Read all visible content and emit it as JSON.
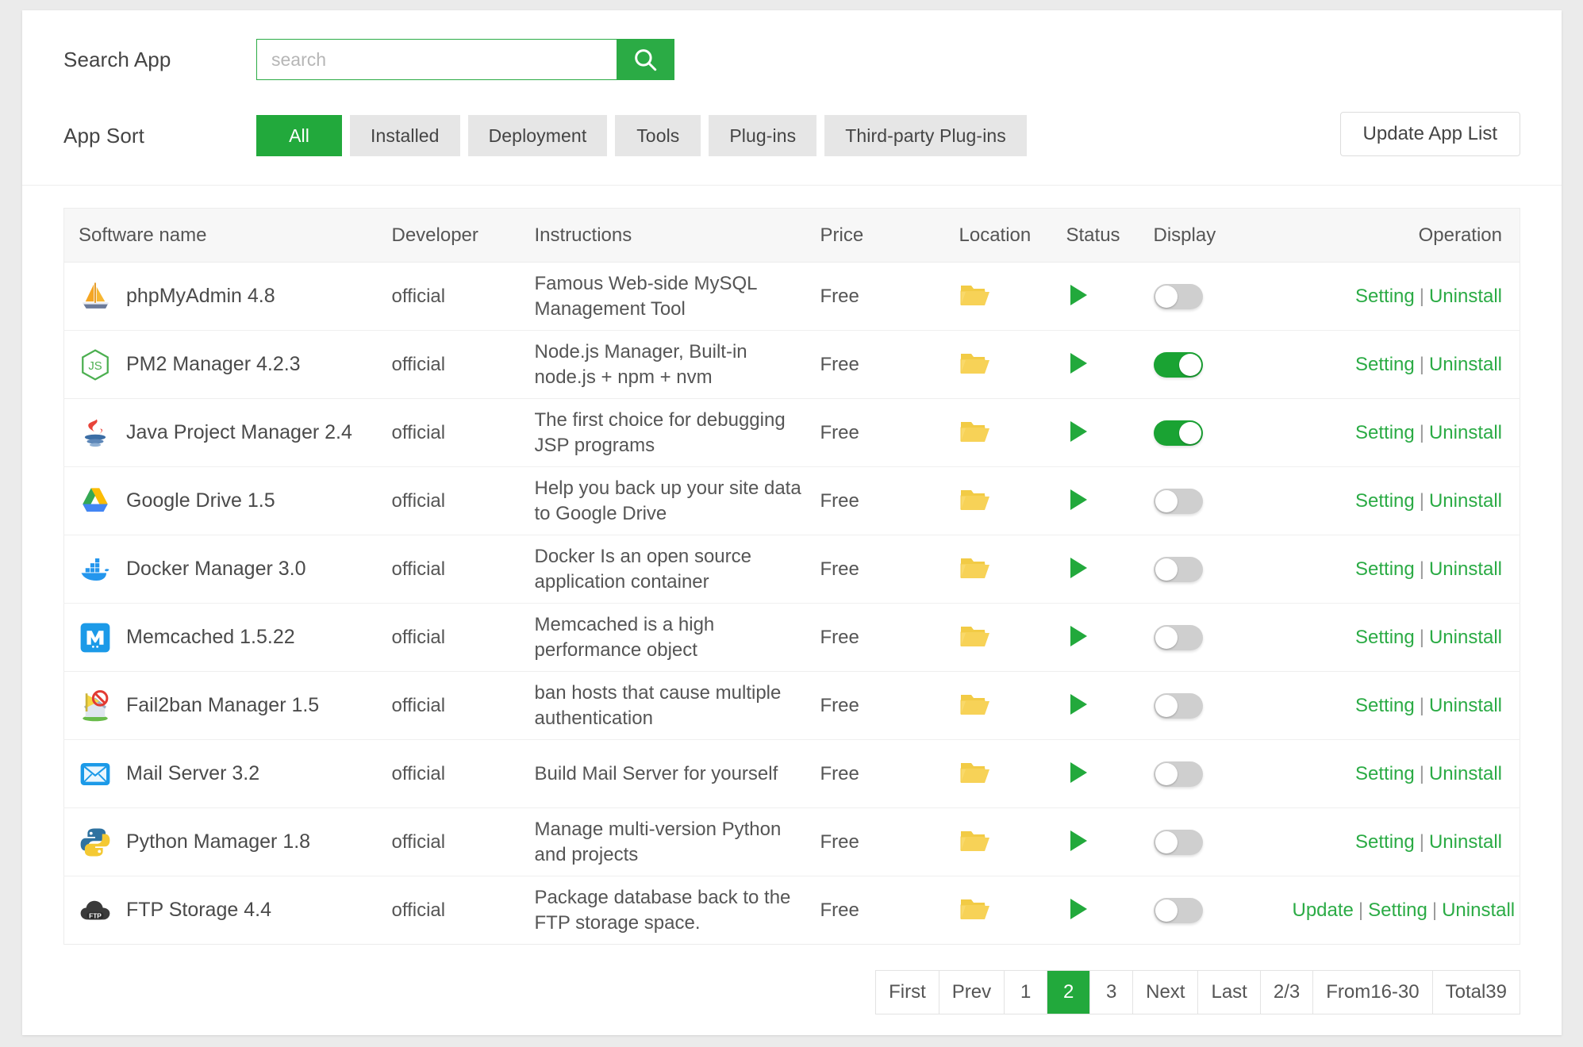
{
  "search": {
    "label": "Search App",
    "placeholder": "search",
    "value": "",
    "button_icon": "search-icon"
  },
  "sort": {
    "label": "App Sort",
    "buttons": [
      {
        "label": "All",
        "active": true
      },
      {
        "label": "Installed",
        "active": false
      },
      {
        "label": "Deployment",
        "active": false
      },
      {
        "label": "Tools",
        "active": false
      },
      {
        "label": "Plug-ins",
        "active": false
      },
      {
        "label": "Third-party Plug-ins",
        "active": false
      }
    ],
    "update_button": "Update App List"
  },
  "table": {
    "headers": {
      "name": "Software name",
      "developer": "Developer",
      "instructions": "Instructions",
      "price": "Price",
      "location": "Location",
      "status": "Status",
      "display": "Display",
      "operation": "Operation"
    },
    "rows": [
      {
        "icon": "phpmyadmin-icon",
        "name": "phpMyAdmin 4.8",
        "developer": "official",
        "instructions": "Famous Web-side MySQL Management Tool",
        "price": "Free",
        "location": "folder-icon",
        "status": "play-icon",
        "display_on": false,
        "ops": [
          "Setting",
          "Uninstall"
        ]
      },
      {
        "icon": "nodejs-icon",
        "name": "PM2 Manager 4.2.3",
        "developer": "official",
        "instructions": "Node.js Manager,  Built-in node.js + npm + nvm",
        "price": "Free",
        "location": "folder-icon",
        "status": "play-icon",
        "display_on": true,
        "ops": [
          "Setting",
          "Uninstall"
        ]
      },
      {
        "icon": "java-icon",
        "name": "Java Project Manager 2.4",
        "developer": "official",
        "instructions": "The first choice for debugging JSP programs",
        "price": "Free",
        "location": "folder-icon",
        "status": "play-icon",
        "display_on": true,
        "ops": [
          "Setting",
          "Uninstall"
        ]
      },
      {
        "icon": "google-drive-icon",
        "name": "Google Drive 1.5",
        "developer": "official",
        "instructions": "Help you back up your site data to Google Drive",
        "price": "Free",
        "location": "folder-icon",
        "status": "play-icon",
        "display_on": false,
        "ops": [
          "Setting",
          "Uninstall"
        ]
      },
      {
        "icon": "docker-icon",
        "name": "Docker Manager 3.0",
        "developer": "official",
        "instructions": "Docker Is an open source application container",
        "price": "Free",
        "location": "folder-icon",
        "status": "play-icon",
        "display_on": false,
        "ops": [
          "Setting",
          "Uninstall"
        ]
      },
      {
        "icon": "memcached-icon",
        "name": "Memcached 1.5.22",
        "developer": "official",
        "instructions": "Memcached is a high performance object",
        "price": "Free",
        "location": "folder-icon",
        "status": "play-icon",
        "display_on": false,
        "ops": [
          "Setting",
          "Uninstall"
        ]
      },
      {
        "icon": "fail2ban-icon",
        "name": "Fail2ban Manager 1.5",
        "developer": "official",
        "instructions": "ban hosts that cause multiple authentication",
        "price": "Free",
        "location": "folder-icon",
        "status": "play-icon",
        "display_on": false,
        "ops": [
          "Setting",
          "Uninstall"
        ]
      },
      {
        "icon": "mail-icon",
        "name": "Mail Server 3.2",
        "developer": "official",
        "instructions": "Build Mail Server for yourself",
        "price": "Free",
        "location": "folder-icon",
        "status": "play-icon",
        "display_on": false,
        "ops": [
          "Setting",
          "Uninstall"
        ]
      },
      {
        "icon": "python-icon",
        "name": "Python Mamager 1.8",
        "developer": "official",
        "instructions": "Manage multi-version Python and projects",
        "price": "Free",
        "location": "folder-icon",
        "status": "play-icon",
        "display_on": false,
        "ops": [
          "Setting",
          "Uninstall"
        ]
      },
      {
        "icon": "ftp-icon",
        "name": "FTP Storage 4.4",
        "developer": "official",
        "instructions": "Package database back to the FTP storage space.",
        "price": "Free",
        "location": "folder-icon",
        "status": "play-icon",
        "display_on": false,
        "ops": [
          "Update",
          "Setting",
          "Uninstall"
        ]
      }
    ]
  },
  "pagination": {
    "first": "First",
    "prev": "Prev",
    "pages": [
      "1",
      "2",
      "3"
    ],
    "active_page": "2",
    "next": "Next",
    "last": "Last",
    "page_ratio": "2/3",
    "range": "From16-30",
    "total": "Total39"
  },
  "colors": {
    "accent_green": "#22a93c",
    "link_green": "#2bab45",
    "toggle_on": "#1aa333",
    "toggle_off": "#cfcfcf",
    "folder_yellow": "#f5cf4c"
  }
}
